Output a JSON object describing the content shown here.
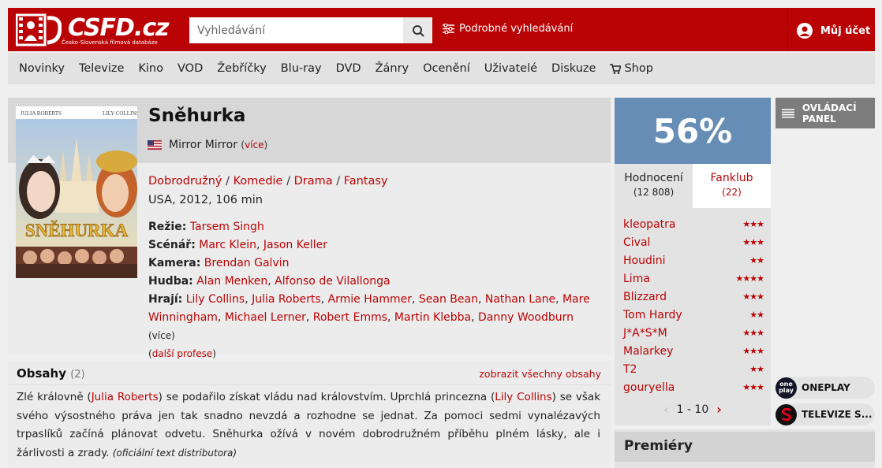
{
  "header": {
    "logo_text": "CSFD.cz",
    "logo_subtitle": "Česko-Slovenská filmová databáze",
    "search_placeholder": "Vyhledávání",
    "advanced_search": "Podrobné vyhledávání",
    "account": "Můj účet"
  },
  "nav": {
    "items": [
      "Novinky",
      "Televize",
      "Kino",
      "VOD",
      "Žebříčky",
      "Blu-ray",
      "DVD",
      "Žánry",
      "Ocenění",
      "Uživatelé",
      "Diskuze"
    ],
    "shop": "Shop"
  },
  "film": {
    "title": "Sněhurka",
    "original_title": "Mirror Mirror",
    "more": "(více)",
    "genres": [
      "Dobrodružný",
      "Komedie",
      "Drama",
      "Fantasy"
    ],
    "origin": "USA, 2012, 106 min",
    "poster": {
      "top_left": "JULIA ROBERTS",
      "top_right": "LILY COLLINS",
      "title": "SNĚHURKA"
    },
    "directing_label": "Režie:",
    "directors": [
      "Tarsem Singh"
    ],
    "writing_label": "Scénář:",
    "writers": [
      "Marc Klein",
      "Jason Keller"
    ],
    "camera_label": "Kamera:",
    "camera": [
      "Brendan Galvin"
    ],
    "music_label": "Hudba:",
    "music": [
      "Alan Menken",
      "Alfonso de Vilallonga"
    ],
    "cast_label": "Hrají:",
    "cast": [
      "Lily Collins",
      "Julia Roberts",
      "Armie Hammer",
      "Sean Bean",
      "Nathan Lane",
      "Mare Winningham",
      "Michael Lerner",
      "Robert Emms",
      "Martin Klebba",
      "Danny Woodburn"
    ],
    "cast_more": "(více)",
    "more_professions": "další profese"
  },
  "plots": {
    "title": "Obsahy",
    "count": "(2)",
    "show_all": "zobrazit všechny obsahy",
    "text_1": "Zlé královně (",
    "link_1": "Julia Roberts",
    "text_2": ") se podařilo získat vládu nad královstvím. Uprchlá princezna (",
    "link_2": "Lily Collins",
    "text_3": ") se však svého výsostného práva jen tak snadno nevzdá a rozhodne se jednat. Za pomoci sedmi vynalézavých trpaslíků začíná plánovat odvetu. Sněhurka ožívá v novém dobrodružném příběhu plném lásky, ale i žárlivosti a zrady.",
    "source": "(oficiální text distributora)"
  },
  "rating": {
    "percent": "56%",
    "color": "#658db5",
    "tab_ratings": "Hodnocení",
    "tab_ratings_count": "(12 808)",
    "tab_fanclub": "Fanklub",
    "tab_fanclub_count": "(22)",
    "users": [
      {
        "name": "kleopatra",
        "stars": 3
      },
      {
        "name": "Cival",
        "stars": 3
      },
      {
        "name": "Houdini",
        "stars": 2
      },
      {
        "name": "Lima",
        "stars": 4
      },
      {
        "name": "Blizzard",
        "stars": 3
      },
      {
        "name": "Tom Hardy",
        "stars": 2
      },
      {
        "name": "J*A*S*M",
        "stars": 3
      },
      {
        "name": "Malarkey",
        "stars": 3
      },
      {
        "name": "T2",
        "stars": 2
      },
      {
        "name": "gouryella",
        "stars": 3
      }
    ],
    "pager": "1 - 10"
  },
  "sidebar": {
    "control_panel": "OVLÁDACÍ PANEL",
    "vod": [
      {
        "label": "ONEPLAY",
        "icon_text": "one play"
      },
      {
        "label": "TELEVIZE S..."
      }
    ],
    "premieres": "Premiéry"
  },
  "colors": {
    "brand": "#ba0305",
    "nav_bg": "#e2e2e2",
    "rating_blue": "#658db5"
  }
}
